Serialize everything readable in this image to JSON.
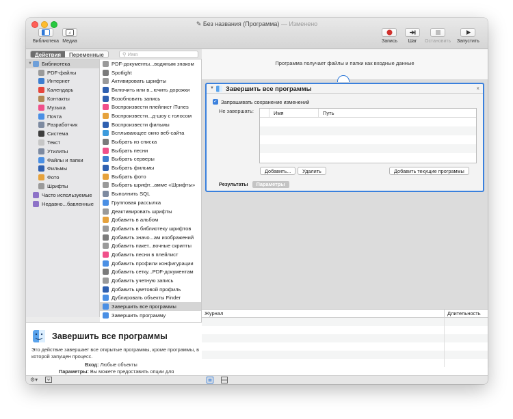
{
  "window": {
    "title": "Без названия (Программа)",
    "edited": "— Изменено"
  },
  "toolbar": {
    "left": [
      {
        "label": "Библиотека",
        "icon": "library-icon"
      },
      {
        "label": "Медиа",
        "icon": "media-icon"
      }
    ],
    "right": [
      {
        "label": "Запись",
        "icon": "record-icon",
        "enabled": true
      },
      {
        "label": "Шаг",
        "icon": "step-icon",
        "enabled": true
      },
      {
        "label": "Остановить",
        "icon": "stop-icon",
        "enabled": false
      },
      {
        "label": "Запустить",
        "icon": "run-icon",
        "enabled": true
      }
    ]
  },
  "tabs": [
    "Действия",
    "Переменные"
  ],
  "search": {
    "placeholder": "Имя"
  },
  "library": [
    {
      "label": "Библиотека",
      "level": 0,
      "icon": "library-folder-icon",
      "color": "#6e9fd9",
      "selected": true,
      "arrow": "▼"
    },
    {
      "label": "PDF-файлы",
      "level": 1,
      "icon": "pdf-icon",
      "color": "#9a9a9a"
    },
    {
      "label": "Интернет",
      "level": 1,
      "icon": "internet-icon",
      "color": "#3d7ed0"
    },
    {
      "label": "Календарь",
      "level": 1,
      "icon": "calendar-icon",
      "color": "#e6463c"
    },
    {
      "label": "Контакты",
      "level": 1,
      "icon": "contacts-icon",
      "color": "#b08a55"
    },
    {
      "label": "Музыка",
      "level": 1,
      "icon": "music-icon",
      "color": "#f0508a"
    },
    {
      "label": "Почта",
      "level": 1,
      "icon": "mail-icon",
      "color": "#4a8fe4"
    },
    {
      "label": "Разработчик",
      "level": 1,
      "icon": "developer-icon",
      "color": "#7d8aa0"
    },
    {
      "label": "Система",
      "level": 1,
      "icon": "system-icon",
      "color": "#3d3d3d"
    },
    {
      "label": "Текст",
      "level": 1,
      "icon": "text-icon",
      "color": "#c6c6c6"
    },
    {
      "label": "Утилиты",
      "level": 1,
      "icon": "utilities-icon",
      "color": "#7d8aa0"
    },
    {
      "label": "Файлы и папки",
      "level": 1,
      "icon": "finder-icon",
      "color": "#4a8fe4"
    },
    {
      "label": "Фильмы",
      "level": 1,
      "icon": "movies-icon",
      "color": "#2f60b0"
    },
    {
      "label": "Фото",
      "level": 1,
      "icon": "photos-icon",
      "color": "#e6a23c"
    },
    {
      "label": "Шрифты",
      "level": 1,
      "icon": "fonts-icon",
      "color": "#9a9a9a"
    },
    {
      "label": "Часто используемые",
      "level": 0,
      "icon": "smart-folder-icon",
      "color": "#8d72c7"
    },
    {
      "label": "Недавно...бавленные",
      "level": 0,
      "icon": "smart-folder-icon",
      "color": "#8d72c7"
    }
  ],
  "actions": [
    {
      "label": "PDF-документы...водяным знаком",
      "icon": "pdf-icon",
      "color": "#9a9a9a"
    },
    {
      "label": "Spotlight",
      "icon": "spotlight-icon",
      "color": "#7b7b7b"
    },
    {
      "label": "Активировать шрифты",
      "icon": "fonts-icon",
      "color": "#9a9a9a"
    },
    {
      "label": "Включить или в...ючить дорожки",
      "icon": "quicktime-icon",
      "color": "#2f60b0"
    },
    {
      "label": "Возобновить запись",
      "icon": "quicktime-icon",
      "color": "#2f60b0"
    },
    {
      "label": "Воспроизвести плейлист iTunes",
      "icon": "music-icon",
      "color": "#f0508a"
    },
    {
      "label": "Воспроизвести...д-шоу с голосом",
      "icon": "photos-icon",
      "color": "#e6a23c"
    },
    {
      "label": "Воспроизвести фильмы",
      "icon": "quicktime-icon",
      "color": "#2f60b0"
    },
    {
      "label": "Всплывающее окно веб-сайта",
      "icon": "safari-icon",
      "color": "#3d9bdc"
    },
    {
      "label": "Выбрать из списка",
      "icon": "pencil-icon",
      "color": "#7b7b7b"
    },
    {
      "label": "Выбрать песни",
      "icon": "music-icon",
      "color": "#f0508a"
    },
    {
      "label": "Выбрать серверы",
      "icon": "globe-icon",
      "color": "#3d7ed0"
    },
    {
      "label": "Выбрать фильмы",
      "icon": "quicktime-icon",
      "color": "#2f60b0"
    },
    {
      "label": "Выбрать фото",
      "icon": "photos-icon",
      "color": "#e6a23c"
    },
    {
      "label": "Выбрать шрифт...амме «Шрифты»",
      "icon": "fonts-icon",
      "color": "#9a9a9a"
    },
    {
      "label": "Выполнить SQL",
      "icon": "developer-icon",
      "color": "#7d8aa0"
    },
    {
      "label": "Групповая рассылка",
      "icon": "mail-icon",
      "color": "#4a8fe4"
    },
    {
      "label": "Деактивировать шрифты",
      "icon": "fonts-icon",
      "color": "#9a9a9a"
    },
    {
      "label": "Добавить в альбом",
      "icon": "photos-icon",
      "color": "#e6a23c"
    },
    {
      "label": "Добавить в библиотеку шрифтов",
      "icon": "fonts-icon",
      "color": "#9a9a9a"
    },
    {
      "label": "Добавить значо...ам изображений",
      "icon": "preview-icon",
      "color": "#7b7b7b"
    },
    {
      "label": "Добавить пакет...вочные скрипты",
      "icon": "package-icon",
      "color": "#9a9a9a"
    },
    {
      "label": "Добавить песни в плейлист",
      "icon": "music-icon",
      "color": "#f0508a"
    },
    {
      "label": "Добавить профили конфигурации",
      "icon": "profile-icon",
      "color": "#4a8fe4"
    },
    {
      "label": "Добавить сетку...PDF-документам",
      "icon": "preview-icon",
      "color": "#7b7b7b"
    },
    {
      "label": "Добавить учетную запись",
      "icon": "package-icon",
      "color": "#9a9a9a"
    },
    {
      "label": "Добавить цветовой профиль",
      "icon": "colorsync-icon",
      "color": "#2f60b0"
    },
    {
      "label": "Дублировать объекты Finder",
      "icon": "finder-icon",
      "color": "#4a8fe4"
    },
    {
      "label": "Завершить все программы",
      "icon": "finder-icon",
      "color": "#4a8fe4",
      "selected": true
    },
    {
      "label": "Завершить программу",
      "icon": "finder-icon",
      "color": "#4a8fe4"
    }
  ],
  "description": {
    "title": "Завершить все программы",
    "text": "Это действие завершает все открытые программы, кроме программы, в которой запущен процесс.",
    "input_label": "Вход:",
    "input_value": "Любые объекты",
    "params_label": "Параметры:",
    "params_value": "Вы можете предоставить опции для"
  },
  "workflow": {
    "input_header": "Программа получает файлы и папки как входные данные",
    "action": {
      "title": "Завершить все программы",
      "close": "×",
      "checkbox_label": "Запрашивать сохранение изменений",
      "checkbox_checked": true,
      "except_label": "Не завершать:",
      "columns": [
        "Имя",
        "Путь"
      ],
      "buttons": [
        "Добавить...",
        "Удалить",
        "Добавить текущие программы"
      ],
      "tabs": [
        "Результаты",
        "Параметры"
      ]
    }
  },
  "log": {
    "columns": [
      "Журнал",
      "Длительность"
    ]
  }
}
